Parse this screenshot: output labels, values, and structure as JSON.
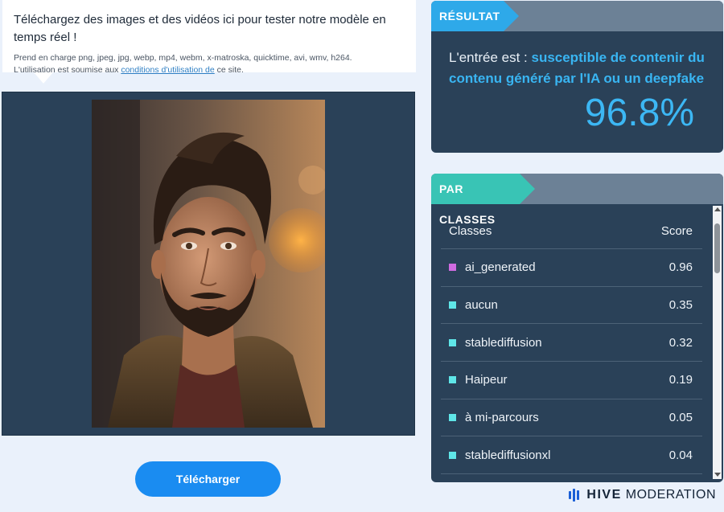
{
  "info": {
    "title": "Téléchargez des images et des vidéos ici pour tester notre modèle en temps réel !",
    "formats": "Prend en charge png, jpeg, jpg, webp, mp4, webm, x-matroska, quicktime, avi, wmv, h264.",
    "terms_prefix": "L'utilisation est soumise aux ",
    "terms_link": "conditions d'utilisation de",
    "terms_suffix": " ce site."
  },
  "upload_button_label": "Télécharger",
  "result": {
    "tag": "RÉSULTAT",
    "lead": "L'entrée est : ",
    "verdict": "susceptible de contenir du contenu généré par l'IA ou un deepfake",
    "percentage": "96.8%"
  },
  "classes": {
    "tag": "PAR CLASSES",
    "header_class": "Classes",
    "header_score": "Score",
    "rows": [
      {
        "name": "ai_generated",
        "score": "0.96",
        "color": "#cf6be0"
      },
      {
        "name": "aucun",
        "score": "0.35",
        "color": "#5fe6e8"
      },
      {
        "name": "stablediffusion",
        "score": "0.32",
        "color": "#5fe6e8"
      },
      {
        "name": "Haipeur",
        "score": "0.19",
        "color": "#5fe6e8"
      },
      {
        "name": "à mi-parcours",
        "score": "0.05",
        "color": "#5fe6e8"
      },
      {
        "name": "stablediffusionxl",
        "score": "0.04",
        "color": "#5fe6e8"
      }
    ]
  },
  "brand": {
    "name": "HIVE",
    "product": "MODERATION"
  },
  "colors": {
    "accent_blue": "#1a8cf1",
    "panel": "#2a4158",
    "result_tag": "#2ea9e9",
    "classes_tag": "#39c4b5"
  }
}
